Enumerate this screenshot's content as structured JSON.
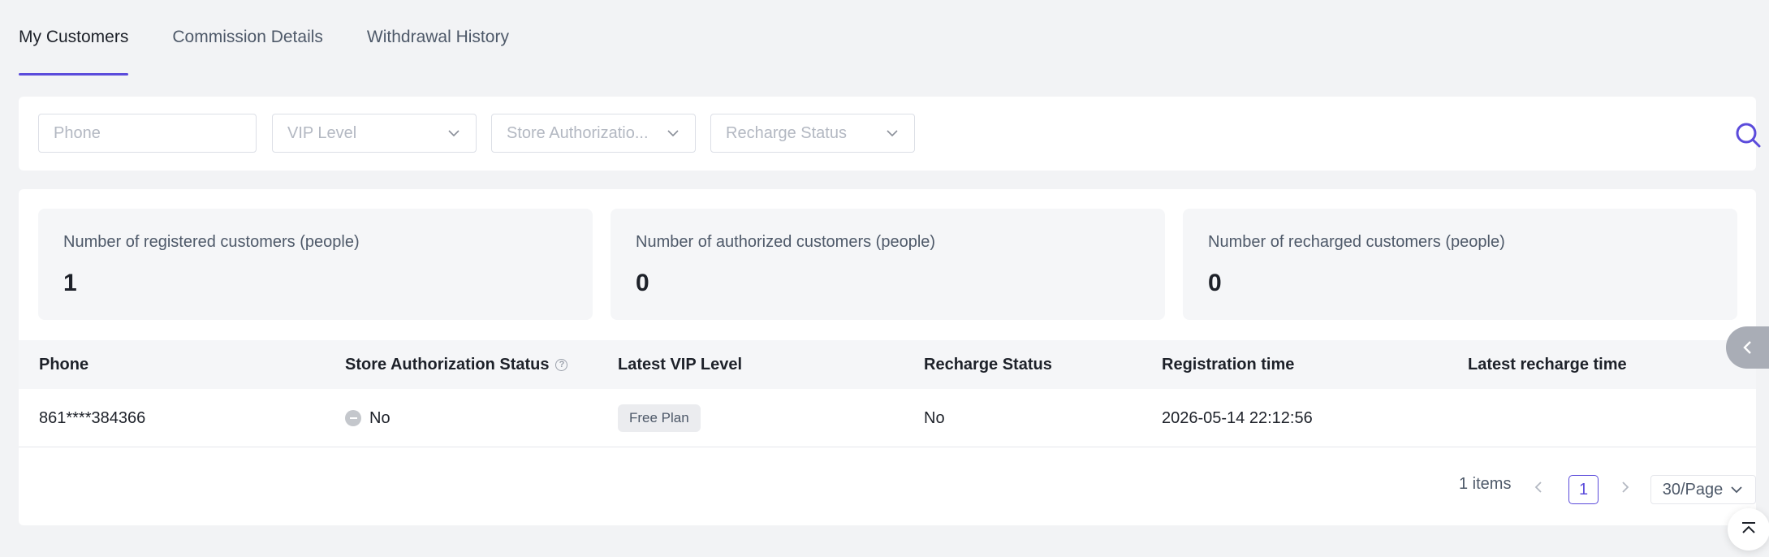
{
  "tabs": [
    {
      "label": "My Customers",
      "active": true
    },
    {
      "label": "Commission Details",
      "active": false
    },
    {
      "label": "Withdrawal History",
      "active": false
    }
  ],
  "filters": {
    "phone_placeholder": "Phone",
    "vip_level": "VIP Level",
    "store_authorization": "Store Authorizatio...",
    "recharge_status": "Recharge Status"
  },
  "stats": [
    {
      "label": "Number of registered customers (people)",
      "value": "1"
    },
    {
      "label": "Number of authorized customers (people)",
      "value": "0"
    },
    {
      "label": "Number of recharged customers (people)",
      "value": "0"
    }
  ],
  "table": {
    "columns": [
      "Phone",
      "Store Authorization Status",
      "Latest VIP Level",
      "Recharge Status",
      "Registration time",
      "Latest recharge time"
    ],
    "rows": [
      {
        "phone": "861****384366",
        "store_authorization": "No",
        "vip_level": "Free Plan",
        "recharge_status": "No",
        "registration_time": "2026-05-14 22:12:56",
        "latest_recharge_time": ""
      }
    ]
  },
  "pagination": {
    "total": "1 items",
    "current_page": "1",
    "page_size": "30/Page"
  },
  "colors": {
    "accent": "#5b4bdb",
    "background": "#f2f3f5"
  },
  "icons": [
    "chevron-down-icon",
    "search-icon",
    "help-icon",
    "chevron-left-icon",
    "chevron-right-icon",
    "back-to-top-icon"
  ]
}
